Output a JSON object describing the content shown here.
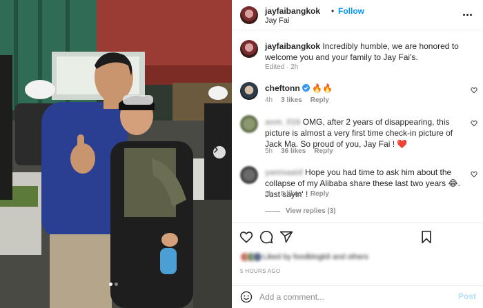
{
  "post": {
    "owner": {
      "username": "jayfaibangkok",
      "location": "Jay Fai",
      "follow_label": "Follow",
      "separator": "•"
    },
    "caption": {
      "username": "jayfaibangkok",
      "text": "Incredibly humble, we are honored to welcome you and your family to Jay Fai's.",
      "meta": "Edited · 2h"
    },
    "comments": [
      {
        "username": "cheftonn",
        "text": "🔥🔥",
        "time": "4h",
        "likes": "3 likes",
        "reply_label": "Reply"
      },
      {
        "username": "aom_016",
        "text": "OMG, after 2 years of disappearing, this picture is almost a very first time check-in picture of Jack Ma. So proud of you, Jay Fai ! ❤️",
        "time": "5h",
        "likes": "36 likes",
        "reply_label": "Reply"
      },
      {
        "username": "yanisaaid",
        "text": "Hope you had time to ask him about the collapse of my Alibaba share these last two years 😂. Just sayin' !",
        "time": "5h",
        "likes": "5 likes",
        "reply_label": "Reply",
        "view_replies": "View replies (3)"
      }
    ],
    "liked_by": "Liked by foodblogk8 and others",
    "time_ago": "5 HOURS AGO",
    "comment_placeholder": "Add a comment...",
    "post_label": "Post",
    "icons": {
      "like": "heart-icon",
      "comment": "comment-icon",
      "share": "paper-plane-icon",
      "save": "bookmark-icon",
      "emoji": "smiley-icon",
      "verified": "verified-badge-icon",
      "more": "more-options-icon",
      "next": "chevron-right-icon"
    },
    "colors": {
      "link_blue": "#0095f6",
      "muted": "#8e8e8e",
      "verified": "#3897f0",
      "post_disabled": "#b2dffc"
    }
  }
}
